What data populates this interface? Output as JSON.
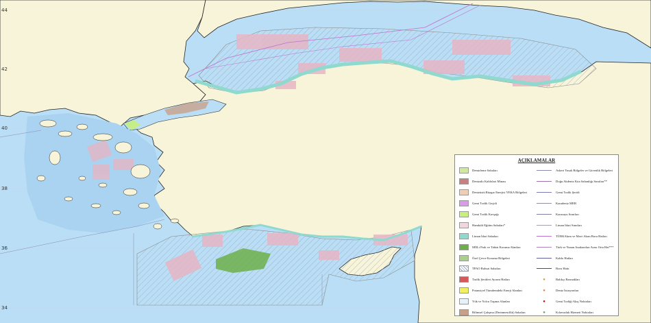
{
  "map": {
    "latitude_labels": [
      "44",
      "42",
      "40",
      "38",
      "36",
      "34"
    ],
    "colors": {
      "sea": "#b9def5",
      "land": "#f7f4d9",
      "coast_line": "#222222",
      "hatch": "#9aa7bd",
      "pink_zone": "#e6b6c6",
      "coastal_zone": "#8fd9cf",
      "green_zone": "#6db04a",
      "border": "#8a8a8a"
    }
  },
  "legend": {
    "title": "AÇIKLAMALAR",
    "left_items": [
      {
        "label": "Demirleme Sahaları",
        "color": "#cfe89a"
      },
      {
        "label": "Denizaltı Kablolari Minası",
        "color": "#c98080"
      },
      {
        "label": "Denizüstü Rüzgar Enerjisi YEKA Bölgeleri",
        "color": "#f2cdb3"
      },
      {
        "label": "Gemi Trafik Geçidi",
        "color": "#d99ae8"
      },
      {
        "label": "Gemi Trafik Kavşağı",
        "color": "#c8f07a"
      },
      {
        "label": "Hamkült Eğitim Sahaları*",
        "color": "#f2d6de"
      },
      {
        "label": "Liman İdari Sahaları",
        "color": "#8fd9cf"
      },
      {
        "label": "MİlLi Park ve Tabiat Koruma Alanları",
        "color": "#6db04a"
      },
      {
        "label": "Özel Çevre Koruma Bölgeleri",
        "color": "#a8d08a"
      },
      {
        "label": "TPAO Ruhsat Sahaları",
        "color": "hatch"
      },
      {
        "label": "Trafik Şeritleri Ayırım Hatları",
        "color": "#d65a5a"
      },
      {
        "label": "Potansiyel Tümdemdeki Enerji Alanları",
        "color": "#f0f060"
      },
      {
        "label": "Yük ve Yolcu Taşıma Alanları",
        "color": "#e6f2f8"
      },
      {
        "label": "Bilimsel Çalışma (Derinmesiflik) Sahaları",
        "color": "#c8a08a"
      }
    ],
    "right_items": [
      {
        "label": "Askeri Yasak Bölgeler ve Güvenlik Bölgeleri",
        "color": "#8a8ab0",
        "kind": "line"
      },
      {
        "label": "Doğu Akdeniz Kıta Sahanlığı Sınırları**",
        "color": "#a070b0",
        "kind": "line"
      },
      {
        "label": "Gemi Trafik Şeridi",
        "color": "#7a7ab8",
        "kind": "line"
      },
      {
        "label": "Karadeniz MEB",
        "color": "#9090a0",
        "kind": "line"
      },
      {
        "label": "Karasuyu Sınırları",
        "color": "#8080a0",
        "kind": "line"
      },
      {
        "label": "Liman İdari Sınırları",
        "color": "#a0a0b0",
        "kind": "line"
      },
      {
        "label": "TÜRKAkım ve Mavi Akım Boru Hatları",
        "color": "#c070d0",
        "kind": "line"
      },
      {
        "label": "Türk ve Yunan Anakaraları Arası Orta Hat***",
        "color": "#b080c0",
        "kind": "line"
      },
      {
        "label": "Kablo Hatları",
        "color": "#6060a0",
        "kind": "line"
      },
      {
        "label": "Boru Hattı",
        "color": "#4040c0",
        "kind": "line"
      },
      {
        "label": "Balıkçı Barınakları",
        "color": "#c0a040",
        "kind": "dot"
      },
      {
        "label": "Deniz İstasyonları",
        "color": "#e08040",
        "kind": "dot"
      },
      {
        "label": "Gemi Trafiği Akış Noktaları",
        "color": "#c00000",
        "kind": "dot"
      },
      {
        "label": "Kılavuzluk Hizmeti Noktaları",
        "color": "#60a060",
        "kind": "dot"
      }
    ]
  }
}
